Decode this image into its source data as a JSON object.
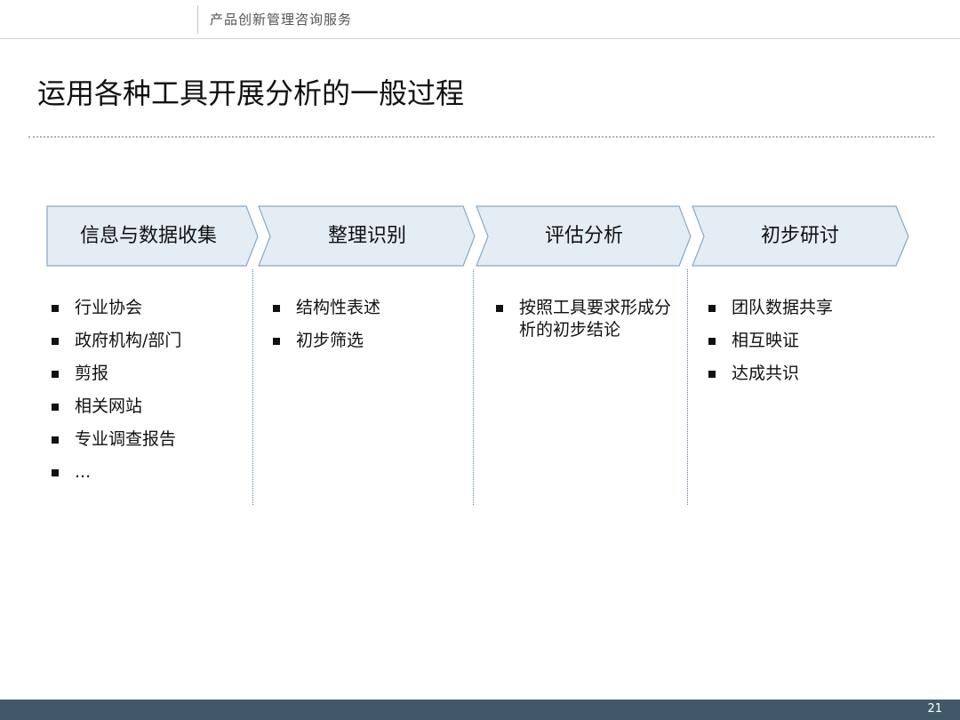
{
  "header": {
    "subtitle": "产品创新管理咨询服务"
  },
  "title": "运用各种工具开展分析的一般过程",
  "steps": [
    {
      "label": "信息与数据收集",
      "items": [
        "行业协会",
        "政府机构/部门",
        "剪报",
        "相关网站",
        "专业调查报告",
        "..."
      ]
    },
    {
      "label": "整理识别",
      "items": [
        "结构性表述",
        "初步筛选"
      ]
    },
    {
      "label": "评估分析",
      "items": [
        "按照工具要求形成分析的初步结论"
      ]
    },
    {
      "label": "初步研讨",
      "items": [
        "团队数据共享",
        "相互映证",
        "达成共识"
      ]
    }
  ],
  "colors": {
    "chevron_fill": "#e4ecf4",
    "chevron_stroke": "#8aa8c4",
    "footer": "#3f5968"
  },
  "footer": {
    "page_number": "21"
  }
}
